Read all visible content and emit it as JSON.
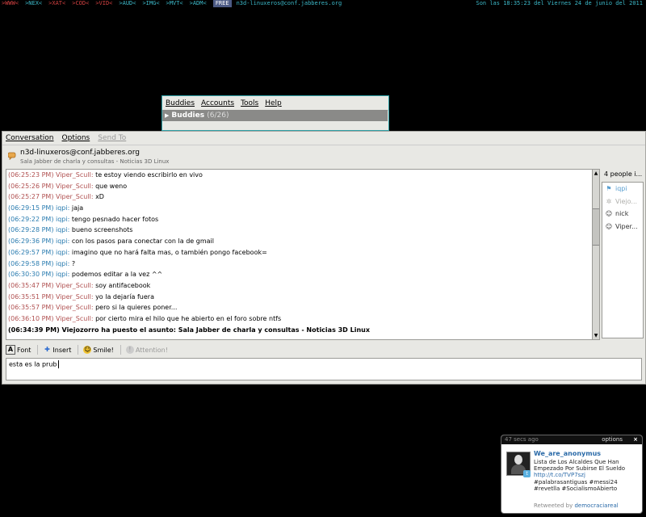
{
  "topbar": {
    "tags": [
      {
        "label": ">WWW<",
        "color": "#d04040"
      },
      {
        "label": ">NEX<",
        "color": "#3cb8c8"
      },
      {
        "label": ">XAT<",
        "color": "#d04040"
      },
      {
        "label": ">COD<",
        "color": "#d04040"
      },
      {
        "label": ">VID<",
        "color": "#d04040"
      },
      {
        "label": ">AUD<",
        "color": "#3cb8c8"
      },
      {
        "label": ">IMG<",
        "color": "#3cb8c8"
      },
      {
        "label": ">MVT<",
        "color": "#3cb8c8"
      },
      {
        "label": ">ADM<",
        "color": "#3cb8c8"
      }
    ],
    "free_label": "FREE",
    "account": "n3d-linuxeros@conf.jabberes.org",
    "clock": "Son las 18:35:23 del Viernes 24 de junio del 2011"
  },
  "buddy_list": {
    "menu": [
      "Buddies",
      "Accounts",
      "Tools",
      "Help"
    ],
    "group_name": "Buddies",
    "group_count": "(6/26)"
  },
  "conversation": {
    "menu": [
      "Conversation",
      "Options",
      "Send To"
    ],
    "room": "n3d-linuxeros@conf.jabberes.org",
    "topic": "Sala Jabber de charla y consultas - Noticias 3D Linux",
    "messages": [
      {
        "time": "(06:25:23 PM)",
        "nick": "Viper_Scull",
        "kind": "v",
        "text": "te estoy viendo escribirlo en vivo"
      },
      {
        "time": "(06:25:26 PM)",
        "nick": "Viper_Scull",
        "kind": "v",
        "text": "que weno"
      },
      {
        "time": "(06:25:27 PM)",
        "nick": "Viper_Scull",
        "kind": "v",
        "text": "xD"
      },
      {
        "time": "(06:29:15 PM)",
        "nick": "iqpi",
        "kind": "i",
        "text": "jaja"
      },
      {
        "time": "(06:29:22 PM)",
        "nick": "iqpi",
        "kind": "i",
        "text": "tengo pesnado hacer fotos"
      },
      {
        "time": "(06:29:28 PM)",
        "nick": "iqpi",
        "kind": "i",
        "text": "bueno screenshots"
      },
      {
        "time": "(06:29:36 PM)",
        "nick": "iqpi",
        "kind": "i",
        "text": "con los pasos para conectar con la de gmail"
      },
      {
        "time": "(06:29:57 PM)",
        "nick": "iqpi",
        "kind": "i",
        "text": "imagino que no hará falta mas, o también pongo facebook="
      },
      {
        "time": "(06:29:58 PM)",
        "nick": "iqpi",
        "kind": "i",
        "text": "?"
      },
      {
        "time": "(06:30:30 PM)",
        "nick": "iqpi",
        "kind": "i",
        "text": "podemos editar a la vez ^^"
      },
      {
        "time": "(06:35:47 PM)",
        "nick": "Viper_Scull",
        "kind": "v",
        "text": "soy antifacebook"
      },
      {
        "time": "(06:35:51 PM)",
        "nick": "Viper_Scull",
        "kind": "v",
        "text": "yo la dejaría fuera"
      },
      {
        "time": "(06:35:57 PM)",
        "nick": "Viper_Scull",
        "kind": "v",
        "text": "pero si la quieres poner..."
      },
      {
        "time": "(06:36:10 PM)",
        "nick": "Viper_Scull",
        "kind": "v",
        "text": "por cierto mira el hilo que he abierto en el foro sobre ntfs"
      },
      {
        "time": "(06:34:39 PM)",
        "nick": "",
        "kind": "sys",
        "text": "Viejozorro ha puesto el asunto: Sala Jabber de charla y consultas - Noticias 3D Linux"
      }
    ],
    "people_title": "4 people i...",
    "people": [
      {
        "name": "iqpi",
        "kind": "op",
        "icon": "flag-icon"
      },
      {
        "name": "Viejo...",
        "kind": "idle",
        "icon": "star-icon"
      },
      {
        "name": "nick",
        "kind": "norm",
        "icon": "user-icon"
      },
      {
        "name": "Viper...",
        "kind": "norm",
        "icon": "user-icon"
      }
    ],
    "toolbar": {
      "font": "Font",
      "insert": "Insert",
      "smile": "Smile!",
      "attention": "Attention!"
    },
    "input_value": "esta es la prub"
  },
  "tweet": {
    "ago": "47 secs ago",
    "options": "options",
    "close": "×",
    "user": "We_are_anonymus",
    "text_plain": "Lista de Los Alcaldes Que Han Empezado Por Subirse El Sueldo",
    "link": "http://t.co/TVP7szj",
    "tags": "#palabrasantiguas #messi24 #revetlla #SocialismoAbierto",
    "retweeted_prefix": "Retweeted by",
    "retweeted_by": "democraciareal"
  }
}
